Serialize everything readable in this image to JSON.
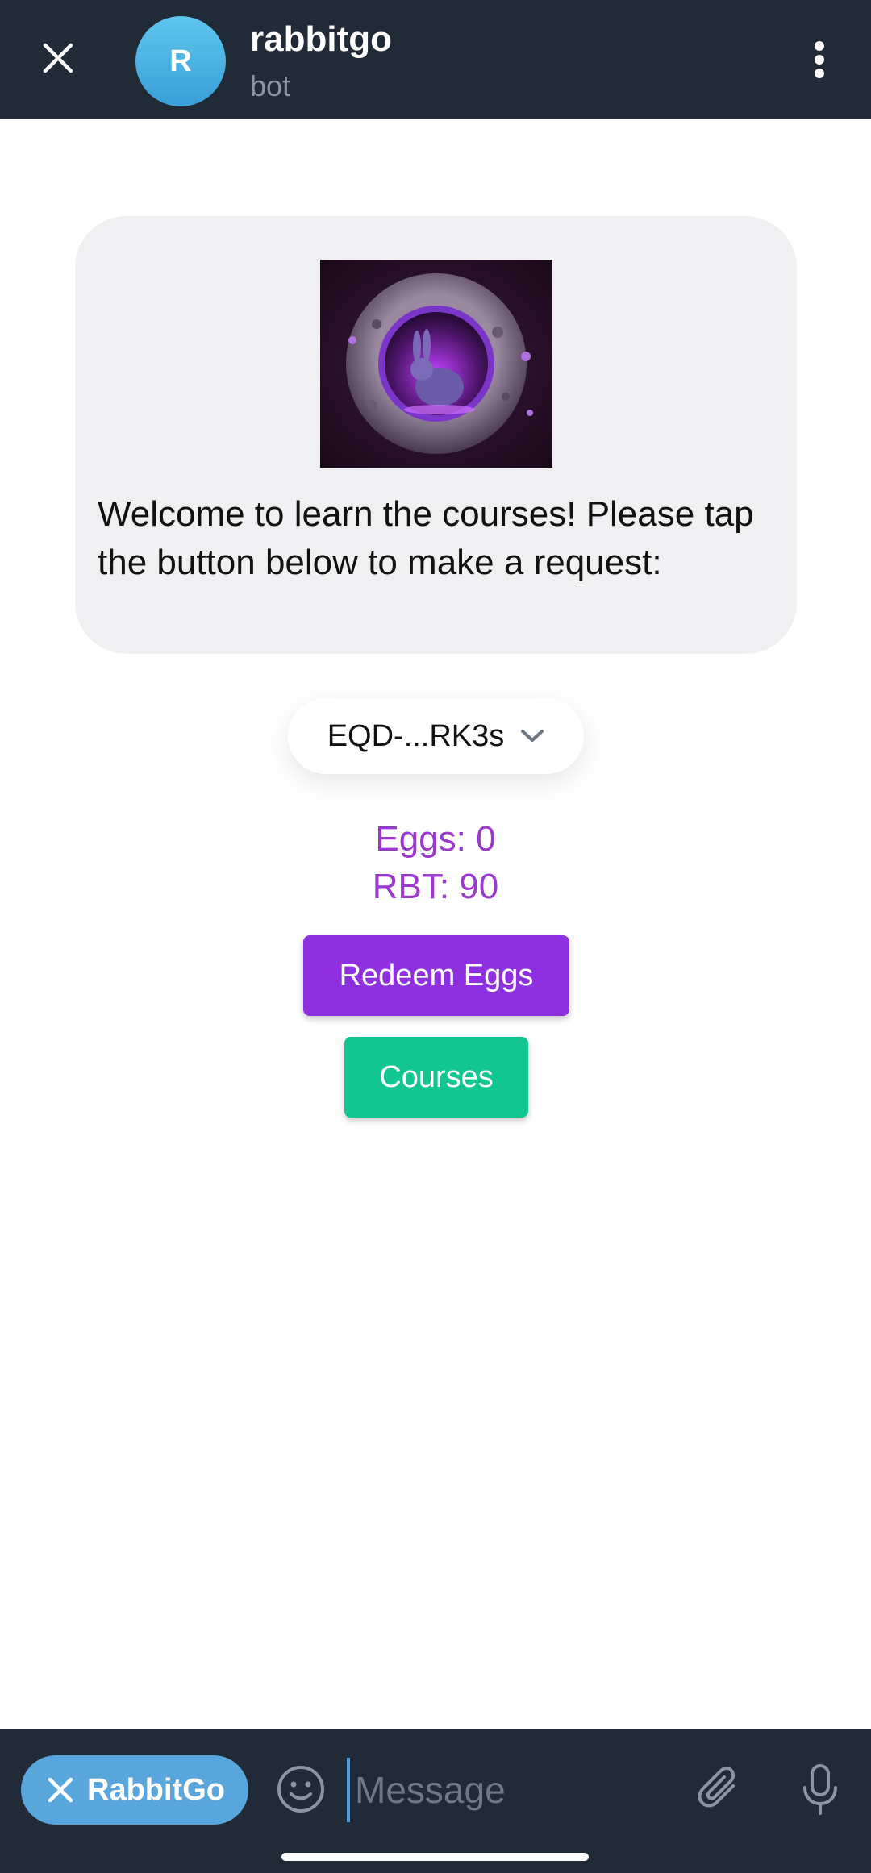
{
  "header": {
    "title": "rabbitgo",
    "subtitle": "bot",
    "avatar_letter": "R"
  },
  "message": {
    "text": "Welcome to learn the courses! Please tap the button below to make a request:"
  },
  "wallet": {
    "address": "EQD-...RK3s"
  },
  "balances": {
    "eggs": "Eggs: 0",
    "rbt": "RBT: 90"
  },
  "buttons": {
    "redeem": "Redeem Eggs",
    "courses": "Courses"
  },
  "composer": {
    "bot_name": "RabbitGo",
    "placeholder": "Message"
  },
  "colors": {
    "header_bg": "#212a37",
    "bubble_bg": "#f0eff2",
    "balance_text": "#9b38cf",
    "redeem_button": "#8e2fe0",
    "courses_button": "#11c690",
    "bot_pill": "#59a6dd"
  },
  "icons": {
    "close": "close-icon",
    "menu": "more-vertical-icon",
    "wallet_dropdown": "chevron-down-icon",
    "emoji": "smile-icon",
    "attach": "paperclip-icon",
    "mic": "microphone-icon"
  }
}
